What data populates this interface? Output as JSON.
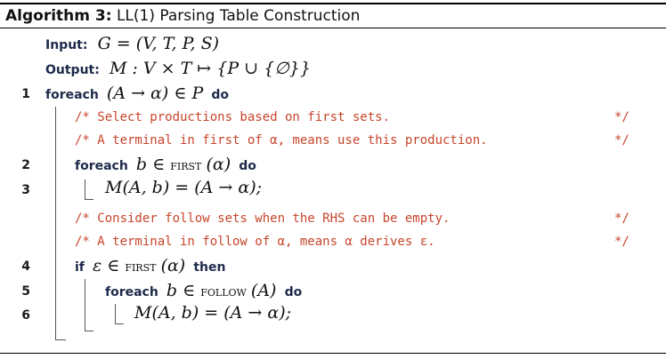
{
  "algorithm": {
    "caption_label": "Algorithm 3:",
    "caption_title": "LL(1) Parsing Table Construction",
    "input_label": "Input:",
    "input_math": "G = (V, T, P, S)",
    "output_label": "Output:",
    "output_math": "M : V × T ↦ {P ∪ {∅}}",
    "kw_foreach": "foreach",
    "kw_do": "do",
    "kw_if": "if",
    "kw_then": "then",
    "fn_first": "first",
    "fn_follow": "follow",
    "lines": [
      {
        "num": "1",
        "math": "(A → α) ∈ P"
      },
      {
        "num": "2",
        "math_left": "b ∈ ",
        "math_arg": "(α)"
      },
      {
        "num": "3",
        "math": "M(A, b) = (A → α);"
      },
      {
        "num": "4",
        "math_left": "ε ∈ ",
        "math_arg": "(α)"
      },
      {
        "num": "5",
        "math_left": "b ∈ ",
        "math_arg": "(A)"
      },
      {
        "num": "6",
        "math": "M(A, b) = (A → α);"
      }
    ],
    "comments": [
      {
        "text": "/* Select productions based on first sets.",
        "end": "*/"
      },
      {
        "text": "/* A terminal in first of α, means use this production.",
        "end": "*/"
      },
      {
        "text": "/* Consider follow sets when the RHS can be empty.",
        "end": "*/"
      },
      {
        "text": "/* A terminal in follow of α, means α derives ε.",
        "end": "*/"
      }
    ]
  }
}
